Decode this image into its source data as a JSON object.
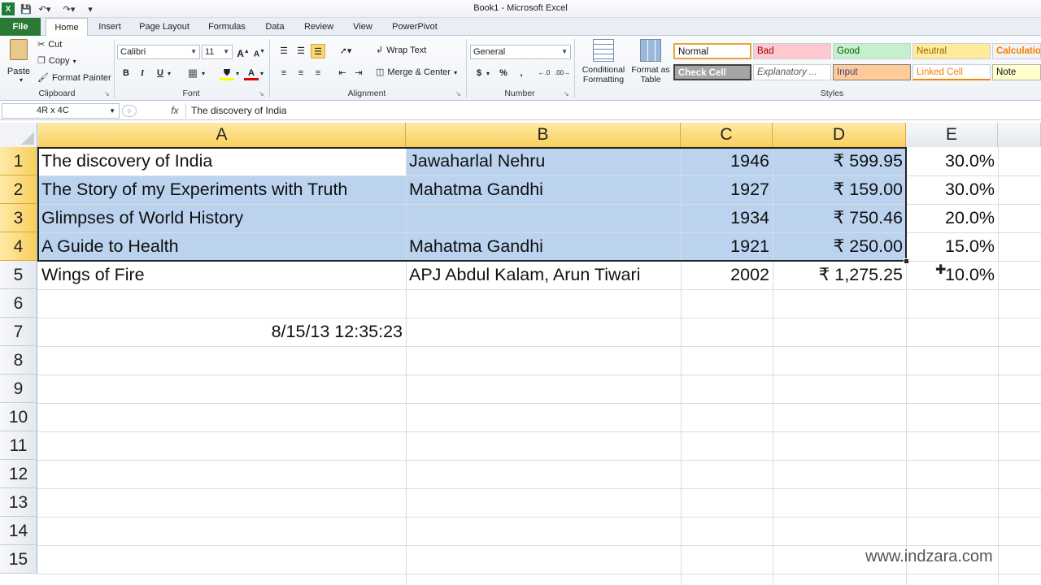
{
  "window": {
    "title": "Book1  -  Microsoft Excel"
  },
  "tabs": [
    "File",
    "Home",
    "Insert",
    "Page Layout",
    "Formulas",
    "Data",
    "Review",
    "View",
    "PowerPivot"
  ],
  "ribbon": {
    "clipboard": {
      "paste": "Paste",
      "cut": "Cut",
      "copy": "Copy",
      "format_painter": "Format Painter",
      "label": "Clipboard"
    },
    "font": {
      "name": "Calibri",
      "size": "11",
      "label": "Font"
    },
    "alignment": {
      "wrap_text": "Wrap Text",
      "merge_center": "Merge & Center",
      "label": "Alignment"
    },
    "number": {
      "format": "General",
      "currency": "$",
      "percent": "%",
      "comma": ",",
      "label": "Number"
    },
    "styles": {
      "conditional_formatting": "Conditional Formatting",
      "format_as_table": "Format as Table",
      "label": "Styles",
      "cells": [
        {
          "name": "Normal",
          "bg": "#ffffff",
          "fg": "#111111",
          "border": "#e4a73b"
        },
        {
          "name": "Bad",
          "bg": "#ffc7ce",
          "fg": "#9c0006"
        },
        {
          "name": "Good",
          "bg": "#c6efce",
          "fg": "#006100"
        },
        {
          "name": "Neutral",
          "bg": "#ffeb9c",
          "fg": "#9c6500"
        },
        {
          "name": "Calculation",
          "bg": "#f2f2f2",
          "fg": "#fa7d00"
        },
        {
          "name": "Check Cell",
          "bg": "#a5a5a5",
          "fg": "#ffffff"
        },
        {
          "name": "Explanatory ...",
          "bg": "#ffffff",
          "fg": "#555555"
        },
        {
          "name": "Input",
          "bg": "#ffcc99",
          "fg": "#3f3f76"
        },
        {
          "name": "Linked Cell",
          "bg": "#ffffff",
          "fg": "#fa7d00"
        },
        {
          "name": "Note",
          "bg": "#ffffcc",
          "fg": "#111111"
        }
      ]
    }
  },
  "formula_bar": {
    "name_box": "4R x 4C",
    "fx": "fx",
    "content": "The discovery of India"
  },
  "columns": [
    "A",
    "B",
    "C",
    "D",
    "E"
  ],
  "rows": [
    "1",
    "2",
    "3",
    "4",
    "5",
    "6",
    "7",
    "8",
    "9",
    "10",
    "11",
    "12",
    "13",
    "14",
    "15"
  ],
  "cells": {
    "r1": {
      "a": "The discovery of India",
      "b": "Jawaharlal Nehru",
      "c": "1946",
      "d": "₹ 599.95",
      "e": "30.0%"
    },
    "r2": {
      "a": "The Story of my Experiments with Truth",
      "b": "Mahatma Gandhi",
      "c": "1927",
      "d": "₹ 159.00",
      "e": "30.0%"
    },
    "r3": {
      "a": "Glimpses of World History",
      "b": "",
      "c": "1934",
      "d": "₹ 750.46",
      "e": "20.0%"
    },
    "r4": {
      "a": "A Guide to Health",
      "b": "Mahatma Gandhi",
      "c": "1921",
      "d": "₹ 250.00",
      "e": "15.0%"
    },
    "r5": {
      "a": "Wings of Fire",
      "b": "APJ Abdul Kalam, Arun Tiwari",
      "c": "2002",
      "d": "₹ 1,275.25",
      "e": "10.0%"
    },
    "r7": {
      "a": "8/15/13 12:35:23"
    }
  },
  "watermark": "www.indzara.com"
}
